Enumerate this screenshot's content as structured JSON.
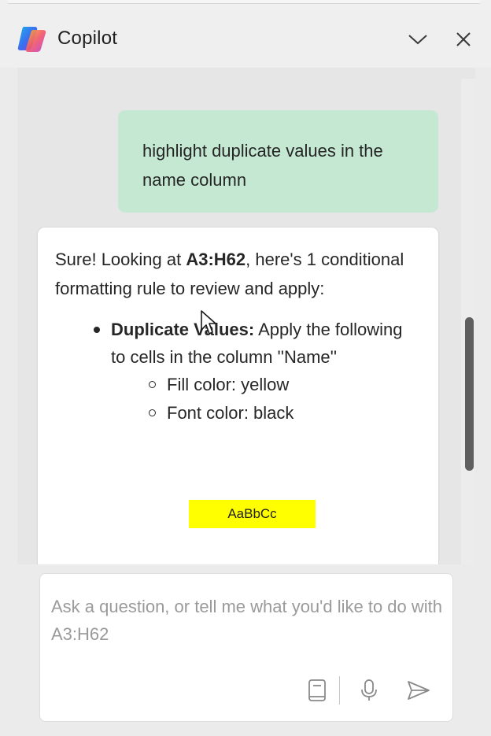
{
  "header": {
    "title": "Copilot",
    "logo_icon": "copilot-logo-icon",
    "collapse_icon": "chevron-down-icon",
    "close_icon": "close-icon"
  },
  "conversation": {
    "user_message": "highlight duplicate values in the name column",
    "bot": {
      "intro_prefix": "Sure! Looking at ",
      "range": "A3:H62",
      "intro_suffix": ", here's 1 conditional formatting rule to review and apply:",
      "rule": {
        "title": "Duplicate Values:",
        "description": " Apply the following to cells in the column ''Name''",
        "formats": [
          "Fill color: yellow",
          "Font color: black"
        ],
        "preview_text": "AaBbCc",
        "preview_fill": "#ffff00",
        "preview_font_color": "#000000"
      }
    }
  },
  "composer": {
    "placeholder": "Ask a question, or tell me what you'd like to do with A3:H62",
    "icons": [
      "notebook-icon",
      "microphone-icon",
      "send-icon"
    ]
  },
  "colors": {
    "user_bubble": "#c5e8d3",
    "panel_background": "#ebebeb",
    "scrollbar_thumb": "#5f5f5f"
  }
}
